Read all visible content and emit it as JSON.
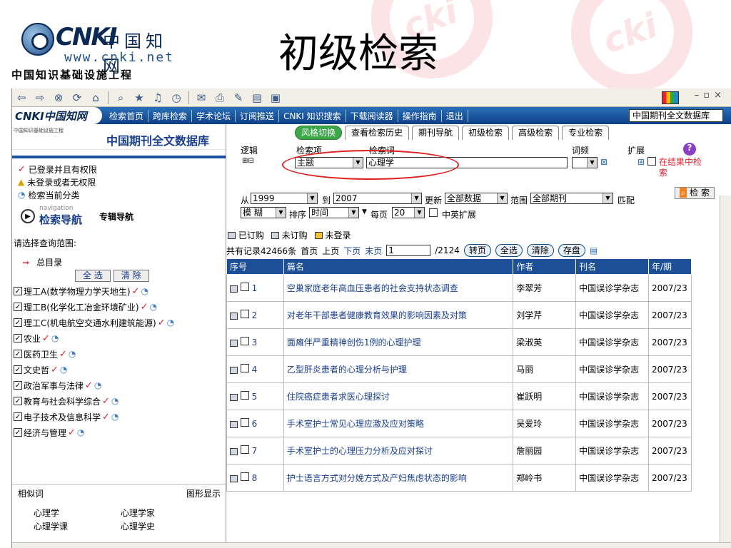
{
  "slide": {
    "logo_text": "CNKI",
    "logo_chinese": "中国知网",
    "logo_url": "www.cnki.net",
    "logo_subtitle": "中国知识基础设施工程",
    "title": "初级检索"
  },
  "browser": {
    "site_nav": {
      "logo_text": "CNKI中国知网",
      "links": [
        "检索首页",
        "跨库检索",
        "学术论坛",
        "订阅推送",
        "CNKI 知识搜索",
        "下载阅读器",
        "操作指南",
        "退出"
      ],
      "db_select": "中国期刊全文数据库"
    },
    "left": {
      "header_small": "中国知识基础设施工程",
      "db_name": "中国期刊全文数据库",
      "status": [
        "已登录并且有权限",
        "未登录或者无权限",
        "检索当前分类"
      ],
      "nav_small": "navigation",
      "nav_label": "检索导航",
      "nav_special": "专辑导航",
      "scope_label": "请选择查询范围:",
      "all_dir": "总目录",
      "select_all": "全 选",
      "clear": "清 除",
      "categories": [
        "理工A(数学物理力学天地生)",
        "理工B(化学化工冶金环境矿业)",
        "理工C(机电航空交通水利建筑能源)",
        "农业",
        "医药卫生",
        "文史哲",
        "政治军事与法律",
        "教育与社会科学综合",
        "电子技术及信息科学",
        "经济与管理"
      ],
      "similar_label": "相似词",
      "graph_label": "图形显示",
      "similar_words": [
        "心理学",
        "心理学家",
        "心理学课",
        "心理学史"
      ]
    },
    "right": {
      "tabs": [
        "风格切换",
        "查看检索历史",
        "期刊导航",
        "初级检索",
        "高级检索",
        "专业检索"
      ],
      "form": {
        "logic_label": "逻辑",
        "field_label": "检索项",
        "term_label": "检索词",
        "freq_label": "词频",
        "expand_label": "扩展",
        "field_value": "主题",
        "term_value": "心理学",
        "in_results": "在结果中检索",
        "search_btn": "检 索",
        "from_label": "从",
        "from_year": "1999",
        "to_label": "到",
        "to_year": "2007",
        "update_label": "更新",
        "update_value": "全部数据",
        "range_label": "范围",
        "range_value": "全部期刊",
        "match_label": "匹配",
        "match_value": "模 糊",
        "sort_label": "排序",
        "sort_value": "时间",
        "per_page_label": "每页",
        "per_page_value": "20",
        "cn_en": "中英扩展"
      },
      "legend": [
        "已订购",
        "未订购",
        "未登录"
      ],
      "pager": {
        "total": "共有记录42466条",
        "first": "首页",
        "prev": "上页",
        "next": "下页",
        "last": "末页",
        "page_value": "1",
        "page_total": "/2124",
        "go": "转页",
        "select_all": "全选",
        "clear": "清除",
        "save": "存盘"
      },
      "table": {
        "headers": [
          "序号",
          "篇名",
          "作者",
          "刊名",
          "年/期"
        ],
        "rows": [
          {
            "no": "1",
            "title": "空巢家庭老年高血压患者的社会支持状态调查",
            "author": "李翠芳",
            "journal": "中国误诊学杂志",
            "issue": "2007/23"
          },
          {
            "no": "2",
            "title": "对老年干部患者健康教育效果的影响因素及对策",
            "author": "刘学芹",
            "journal": "中国误诊学杂志",
            "issue": "2007/23"
          },
          {
            "no": "3",
            "title": "面瘫伴严重精神创伤1例的心理护理",
            "author": "梁淑英",
            "journal": "中国误诊学杂志",
            "issue": "2007/23"
          },
          {
            "no": "4",
            "title": "乙型肝炎患者的心理分析与护理",
            "author": "马丽",
            "journal": "中国误诊学杂志",
            "issue": "2007/23"
          },
          {
            "no": "5",
            "title": "住院癌症患者求医心理探讨",
            "author": "崔跃明",
            "journal": "中国误诊学杂志",
            "issue": "2007/23"
          },
          {
            "no": "6",
            "title": "手术室护士常见心理应激及应对策略",
            "author": "吴爱玲",
            "journal": "中国误诊学杂志",
            "issue": "2007/23"
          },
          {
            "no": "7",
            "title": "手术室护士的心理压力分析及应对探讨",
            "author": "詹丽园",
            "journal": "中国误诊学杂志",
            "issue": "2007/23"
          },
          {
            "no": "8",
            "title": "护士语言方式对分娩方式及产妇焦虑状态的影响",
            "author": "郑岭书",
            "journal": "中国误诊学杂志",
            "issue": "2007/23"
          }
        ]
      }
    }
  }
}
